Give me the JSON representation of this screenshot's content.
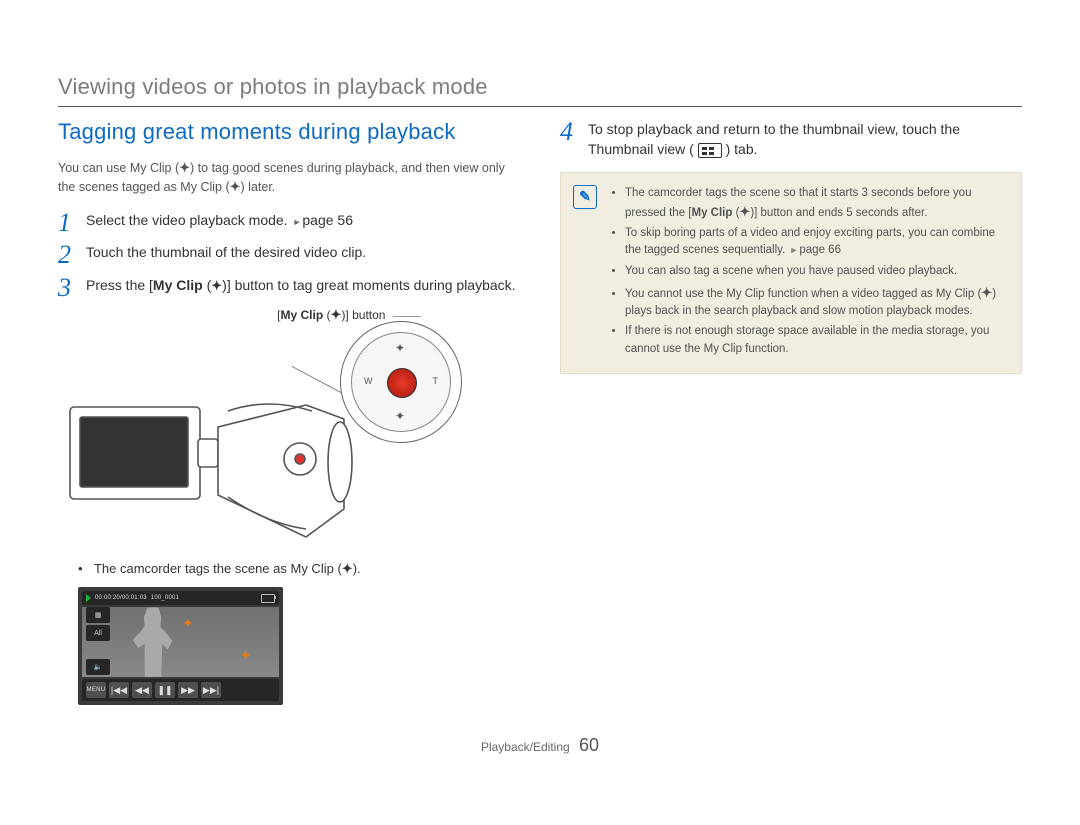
{
  "section_title": "Viewing videos or photos in playback mode",
  "sub_heading": "Tagging great moments during playback",
  "intro": {
    "p1a": "You can use My Clip (",
    "p1b": ") to tag good scenes during playback, and then view only the scenes tagged as My Clip (",
    "p1c": ") later."
  },
  "steps": {
    "s1a": "Select the video playback mode. ",
    "s1b": "page 56",
    "s2": "Touch the thumbnail of the desired video clip.",
    "s3a": "Press the [",
    "s3b": "My Clip",
    "s3c": " (",
    "s3d": ")] button to tag great moments during playback.",
    "s4a": "To stop playback and return to the thumbnail view, touch the Thumbnail view (",
    "s4b": ") tab."
  },
  "callout": {
    "pre": "[",
    "bold": "My Clip",
    "mid": " (",
    "post": ")] button"
  },
  "bullet": {
    "a": "The camcorder tags the scene as My Clip (",
    "b": ")."
  },
  "screenshot": {
    "time": "00:00:20/00:01:03",
    "file": "100_0001",
    "left1": "▢",
    "left2": "All",
    "vol": "🔈",
    "menu": "MENU",
    "btn_prev": "|◀◀",
    "btn_rw": "◀◀",
    "btn_pause": "❚❚",
    "btn_ff": "▶▶",
    "btn_next": "▶▶|"
  },
  "tips": {
    "t1a": "The camcorder tags the scene so that it starts 3 seconds before you pressed the [",
    "t1b": "My Clip",
    "t1c": " (",
    "t1d": ")] button and ends 5 seconds after.",
    "t2a": "To skip boring parts of a video and enjoy exciting parts, you can combine the tagged scenes sequentially. ",
    "t2b": "page 66",
    "t3": "You can also tag a scene when you have paused video playback.",
    "t4a": "You cannot use the My Clip function when a video tagged as My Clip (",
    "t4b": ") plays back in the search playback and slow motion playback modes.",
    "t5": "If there is not enough storage space available in the media storage, you cannot use the My Clip function."
  },
  "dial": {
    "w": "W",
    "t": "T",
    "glyph": "✦"
  },
  "footer": {
    "chapter": "Playback/Editing",
    "page": "60"
  },
  "glyph": {
    "myclip": "✦"
  }
}
